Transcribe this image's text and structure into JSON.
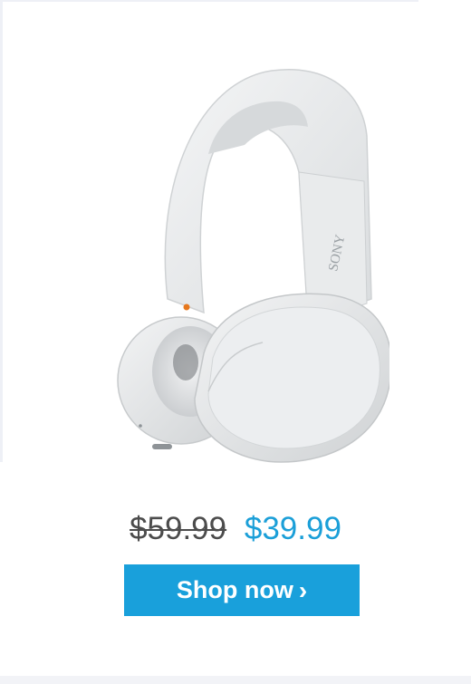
{
  "product": {
    "image_icon": "white-over-ear-headphones-icon",
    "image_brand_text": "SONY"
  },
  "pricing": {
    "old_price": "$59.99",
    "new_price": "$39.99"
  },
  "cta": {
    "label": "Shop now",
    "chevron": "›",
    "icon": "chevron-right-icon"
  },
  "colors": {
    "accent": "#19a0db",
    "sale_price": "#1b9fd8",
    "old_price": "#4c4c4c",
    "background": "#ffffff"
  }
}
